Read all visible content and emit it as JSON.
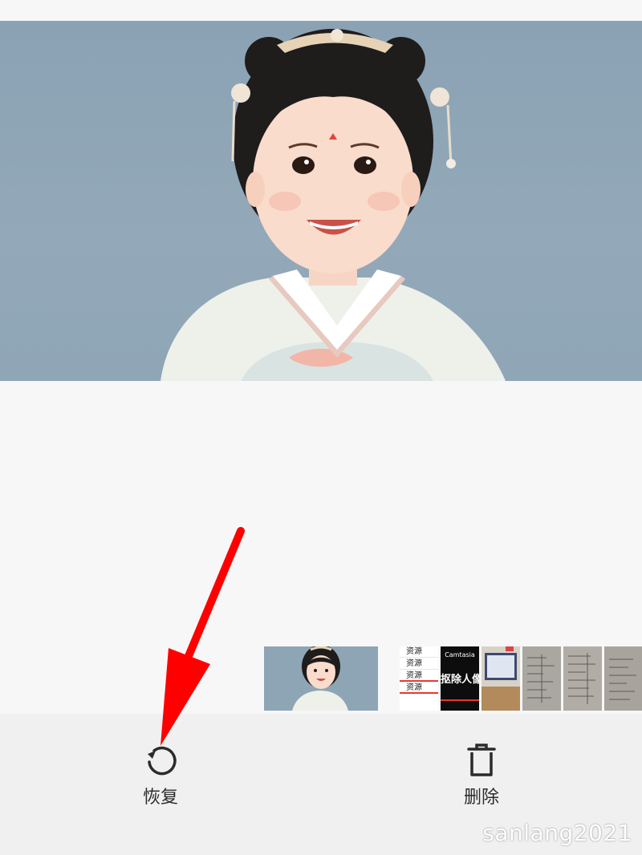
{
  "toolbar": {
    "restore_label": "恢复",
    "delete_label": "删除"
  },
  "filmstrip": {
    "thumb1_rows": [
      "资源",
      "资源",
      "资源",
      "资源"
    ],
    "thumb2_title": "Camtasia",
    "thumb2_caption": "抠除人像"
  },
  "watermark": "sanlang2021",
  "colors": {
    "annotation_arrow": "#ff0000",
    "toolbar_bg": "#f0f0f0",
    "icon_color": "#2b2b2b"
  },
  "icons": {
    "restore": "restore-icon",
    "delete": "trash-icon"
  }
}
